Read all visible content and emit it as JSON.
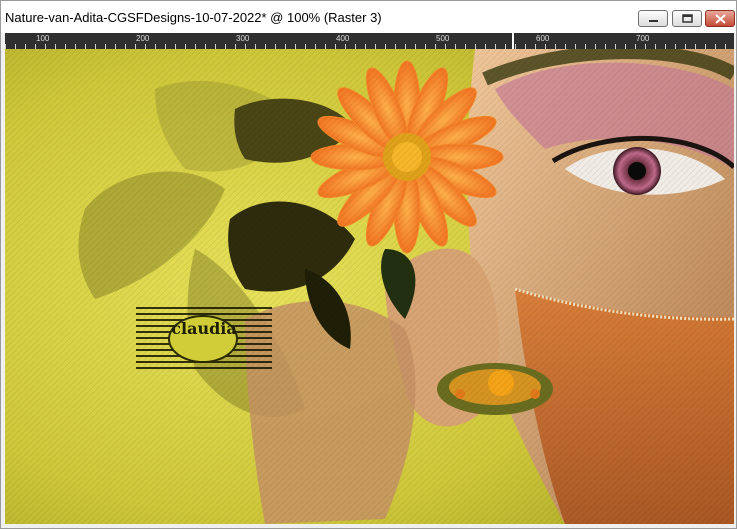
{
  "window": {
    "title": "Nature-van-Adita-CGSFDesigns-10-07-2022* @ 100% (Raster 3)",
    "buttons": {
      "minimize": "minimize-icon",
      "maximize": "maximize-icon",
      "close": "close-icon"
    }
  },
  "ruler": {
    "ticks": [
      "100",
      "200",
      "300",
      "400",
      "500",
      "600",
      "700"
    ]
  },
  "canvas": {
    "watermark_text": "claudia",
    "colors": {
      "background": "#c8c33a",
      "flower": "#f07a1c",
      "skin": "#d9a073",
      "leaf": "#3d3a10"
    }
  }
}
